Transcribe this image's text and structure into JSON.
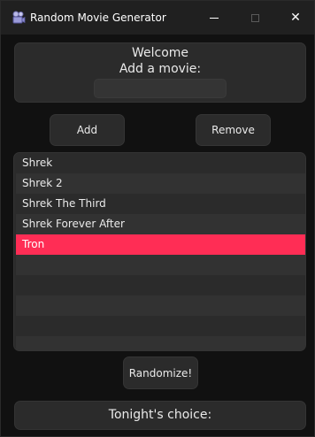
{
  "window": {
    "title": "Random Movie Generator",
    "minimize_icon": "minimize-icon",
    "maximize_icon": "maximize-icon",
    "close_icon": "close-icon",
    "close_glyph": "✕"
  },
  "header": {
    "welcome": "Welcome",
    "prompt": "Add a movie:",
    "input_value": ""
  },
  "buttons": {
    "add": "Add",
    "remove": "Remove",
    "randomize": "Randomize!"
  },
  "movies": {
    "items": [
      "Shrek",
      "Shrek 2",
      "Shrek The Third",
      "Shrek Forever After",
      "Tron"
    ],
    "selected_index": 4,
    "empty_rows": 5
  },
  "footer": {
    "choice_label": "Tonight's choice:"
  },
  "colors": {
    "accent": "#ff2d55",
    "background": "#111111",
    "panel": "#2b2b2b"
  }
}
